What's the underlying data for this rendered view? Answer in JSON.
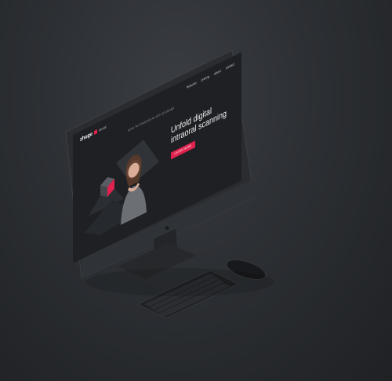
{
  "scene": {
    "background": "#2c2f33",
    "accent": "#e0224f"
  },
  "site": {
    "logo": {
      "text": "zhuge",
      "sub": "dental"
    },
    "nav": [
      "features",
      "pricing",
      "about",
      "contact"
    ],
    "tagline": "how to choose an ios scanner",
    "hero": {
      "title": "Unfold digital intraoral scanning",
      "text": "",
      "cta": "learn more"
    }
  },
  "devices": {
    "monitor": "monitor",
    "keyboard": "keyboard",
    "mouse": "mouse"
  }
}
